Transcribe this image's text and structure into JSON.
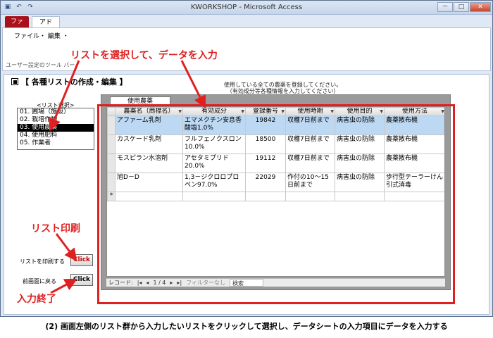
{
  "window": {
    "title": "KWORKSHOP - Microsoft Access",
    "controls": [
      "－",
      "□",
      "✕"
    ]
  },
  "ribbon": {
    "tabs": [
      "ファイル",
      "アドイン"
    ],
    "menu": "ファイル・ 編集 ・",
    "group_label": "ユーザー設定のツール バー"
  },
  "form": {
    "header": "【 各種リストの作成・編集 】",
    "notice_line1": "使用している全ての農薬を登録してください。",
    "notice_line2": "（有効成分等各種情報を入力してください）",
    "list_label": "<リスト選択>",
    "list_items": [
      "01. 圃場（施設）",
      "02. 栽培作物",
      "03. 使用農薬",
      "04. 使用肥料",
      "05. 作業者"
    ],
    "selected_index": 2,
    "datasheet_tab": "使用農薬",
    "print_label": "リストを印刷する",
    "back_label": "前画面に戻る",
    "click_label": "Click"
  },
  "datasheet": {
    "columns": [
      "農薬名（商標名）",
      "有効成分",
      "登録番号",
      "使用時期",
      "使用目的",
      "使用方法"
    ],
    "rows": [
      [
        "アファーム乳剤",
        "エマメクチン安息香酸塩1.0%",
        "19842",
        "収穫7日前まで",
        "病害虫の防除",
        "農薬散布機"
      ],
      [
        "カスケード乳剤",
        "フルフェノクスロン10.0%",
        "18500",
        "収穫7日前まで",
        "病害虫の防除",
        "農薬散布機"
      ],
      [
        "モスピラン水溶剤",
        "アセタミプリド20.0%",
        "19112",
        "収穫7日前まで",
        "病害虫の防除",
        "農薬散布機"
      ],
      [
        "旭D－D",
        "1,3－ジクロロプロペン97.0%",
        "22029",
        "作付の10～15日前まで",
        "病害虫の防除",
        "歩行型テーラーけん引式消毒"
      ]
    ],
    "new_row_marker": "*",
    "nav": {
      "record_label": "レコード:",
      "position": "1 / 4",
      "filter": "フィルターなし",
      "search": "検索"
    }
  },
  "annotations": {
    "select_list": "リストを選択して、データを入力",
    "print_list": "リスト印刷",
    "end_input": "入力終了",
    "color": "#e02020"
  },
  "caption": "(2) 画面左側のリスト群から入力したいリストをクリックして選択し、データシートの入力項目にデータを入力する"
}
